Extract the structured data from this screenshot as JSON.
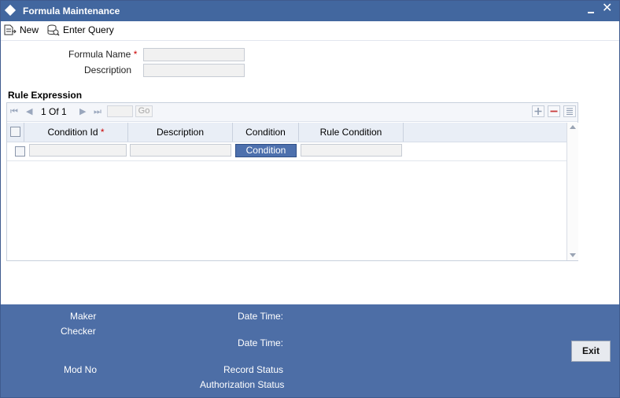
{
  "window": {
    "title": "Formula Maintenance"
  },
  "toolbar": {
    "new_label": "New",
    "enter_query_label": "Enter Query"
  },
  "form": {
    "formula_name_label": "Formula Name",
    "required_mark": "*",
    "formula_name_value": "",
    "description_label": "Description",
    "description_value": ""
  },
  "rule_expression": {
    "title": "Rule Expression",
    "pager": {
      "page_text": "1 Of 1",
      "page_input": "",
      "go_label": "Go"
    },
    "columns": [
      "Condition Id",
      "Description",
      "Condition",
      "Rule Condition"
    ],
    "rows": [
      {
        "condition_id": "",
        "description": "",
        "condition_button": "Condition",
        "rule_condition": ""
      }
    ]
  },
  "footer": {
    "maker_label": "Maker",
    "checker_label": "Checker",
    "date_time_label": "Date Time:",
    "mod_no_label": "Mod No",
    "record_status_label": "Record Status",
    "authorization_status_label": "Authorization Status",
    "exit_label": "Exit"
  },
  "icons": [
    "diamond-icon",
    "minimize-icon",
    "close-icon",
    "new-doc-icon",
    "enter-query-icon",
    "first-page-icon",
    "prev-page-icon",
    "next-page-icon",
    "last-page-icon",
    "add-row-icon",
    "delete-row-icon",
    "single-view-icon"
  ],
  "colors": {
    "titlebar": "#42679f",
    "footer": "#4d6ea6",
    "button_blue": "#4d70ad",
    "required": "#cc0000"
  }
}
